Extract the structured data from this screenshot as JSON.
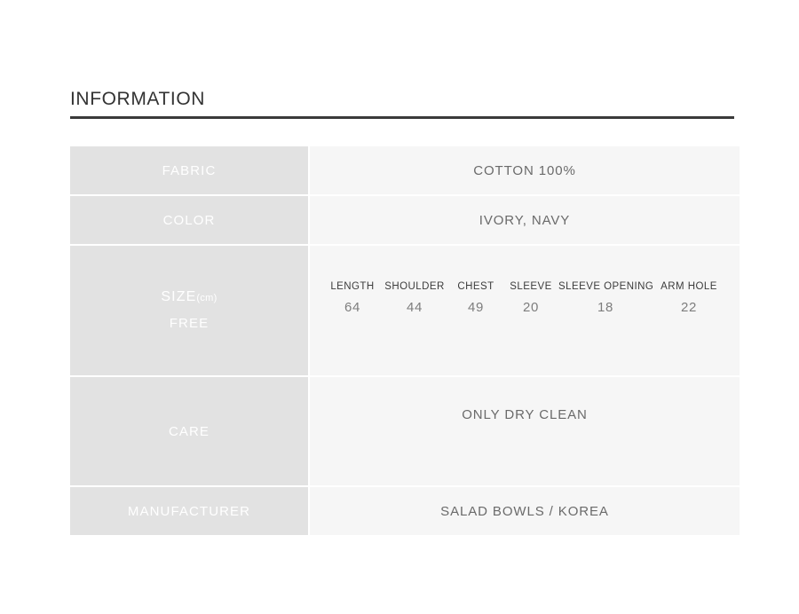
{
  "section": {
    "title": "INFORMATION"
  },
  "table": {
    "rows": [
      {
        "label": "FABRIC",
        "value": "COTTON 100%"
      },
      {
        "label": "COLOR",
        "value": "IVORY, NAVY"
      },
      {
        "label": "SIZE",
        "unit": "(cm)",
        "label_line2": "FREE"
      },
      {
        "label": "CARE",
        "value": "ONLY DRY CLEAN"
      },
      {
        "label": "MANUFACTURER",
        "value": "SALAD BOWLS / KOREA"
      }
    ]
  },
  "measurements": {
    "headers": [
      "LENGTH",
      "SHOULDER",
      "CHEST",
      "SLEEVE",
      "SLEEVE OPENING",
      "ARM HOLE"
    ],
    "values": [
      "64",
      "44",
      "49",
      "20",
      "18",
      "22"
    ]
  },
  "colors": {
    "rule": "#3a3a3a",
    "label_cell_bg": "#e2e2e2",
    "value_cell_bg": "#f6f6f6",
    "label_text": "#ffffff",
    "value_text": "#6a6a6a"
  }
}
